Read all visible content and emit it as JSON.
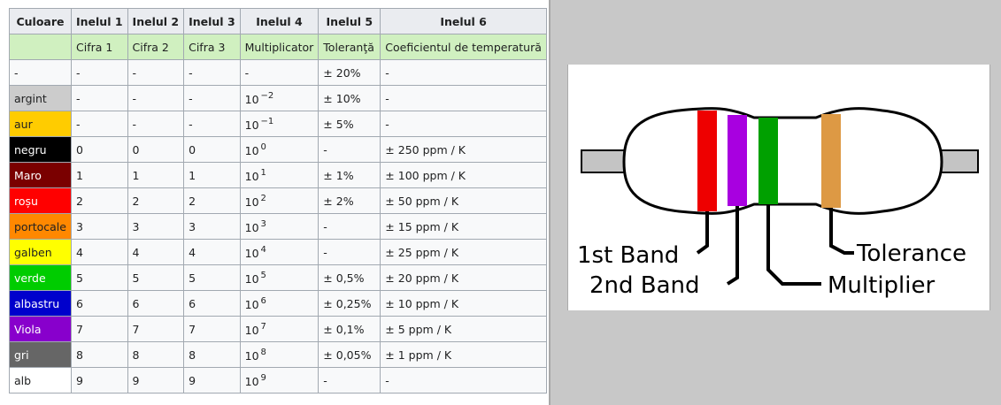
{
  "table": {
    "headers": [
      "Culoare",
      "Inelul 1",
      "Inelul 2",
      "Inelul 3",
      "Inelul 4",
      "Inelul 5",
      "Inelul 6"
    ],
    "subheaders": [
      "",
      "Cifra 1",
      "Cifra 2",
      "Cifra 3",
      "Multiplicator",
      "Toleranţă",
      "Coeficientul de temperatură"
    ],
    "rows": [
      {
        "color": "-",
        "bg": "#f8f9fa",
        "fg": "#202122",
        "d1": "-",
        "d2": "-",
        "d3": "-",
        "mult_base": "-",
        "mult_exp": "",
        "tol": "± 20%",
        "coef": "-"
      },
      {
        "color": "argint",
        "bg": "#cccccc",
        "fg": "#202122",
        "d1": "-",
        "d2": "-",
        "d3": "-",
        "mult_base": "10",
        "mult_exp": "−2",
        "tol": "± 10%",
        "coef": "-"
      },
      {
        "color": "aur",
        "bg": "#ffcc00",
        "fg": "#202122",
        "d1": "-",
        "d2": "-",
        "d3": "-",
        "mult_base": "10",
        "mult_exp": "−1",
        "tol": "± 5%",
        "coef": "-"
      },
      {
        "color": "negru",
        "bg": "#000000",
        "fg": "#ffffff",
        "d1": "0",
        "d2": "0",
        "d3": "0",
        "mult_base": "10",
        "mult_exp": "0",
        "tol": "-",
        "coef": "± 250 ppm / K"
      },
      {
        "color": "Maro",
        "bg": "#7a0000",
        "fg": "#ffffff",
        "d1": "1",
        "d2": "1",
        "d3": "1",
        "mult_base": "10",
        "mult_exp": "1",
        "tol": "± 1%",
        "coef": "± 100 ppm / K"
      },
      {
        "color": "roșu",
        "bg": "#ff0000",
        "fg": "#ffffff",
        "d1": "2",
        "d2": "2",
        "d3": "2",
        "mult_base": "10",
        "mult_exp": "2",
        "tol": "± 2%",
        "coef": "± 50 ppm / K"
      },
      {
        "color": "portocale",
        "bg": "#ff8800",
        "fg": "#202122",
        "d1": "3",
        "d2": "3",
        "d3": "3",
        "mult_base": "10",
        "mult_exp": "3",
        "tol": "-",
        "coef": "± 15 ppm / K"
      },
      {
        "color": "galben",
        "bg": "#ffff00",
        "fg": "#202122",
        "d1": "4",
        "d2": "4",
        "d3": "4",
        "mult_base": "10",
        "mult_exp": "4",
        "tol": "-",
        "coef": "± 25 ppm / K"
      },
      {
        "color": "verde",
        "bg": "#00cc00",
        "fg": "#ffffff",
        "d1": "5",
        "d2": "5",
        "d3": "5",
        "mult_base": "10",
        "mult_exp": "5",
        "tol": "± 0,5%",
        "coef": "± 20 ppm / K"
      },
      {
        "color": "albastru",
        "bg": "#0000cc",
        "fg": "#ffffff",
        "d1": "6",
        "d2": "6",
        "d3": "6",
        "mult_base": "10",
        "mult_exp": "6",
        "tol": "± 0,25%",
        "coef": "± 10 ppm / K"
      },
      {
        "color": "Viola",
        "bg": "#8800cc",
        "fg": "#ffffff",
        "d1": "7",
        "d2": "7",
        "d3": "7",
        "mult_base": "10",
        "mult_exp": "7",
        "tol": "± 0,1%",
        "coef": "± 5 ppm / K"
      },
      {
        "color": "gri",
        "bg": "#666666",
        "fg": "#ffffff",
        "d1": "8",
        "d2": "8",
        "d3": "8",
        "mult_base": "10",
        "mult_exp": "8",
        "tol": "± 0,05%",
        "coef": "± 1 ppm / K"
      },
      {
        "color": "alb",
        "bg": "#ffffff",
        "fg": "#202122",
        "d1": "9",
        "d2": "9",
        "d3": "9",
        "mult_base": "10",
        "mult_exp": "9",
        "tol": "-",
        "coef": "-"
      }
    ]
  },
  "diagram": {
    "labels": {
      "band1": "1st Band",
      "band2": "2nd Band",
      "multiplier": "Multiplier",
      "tolerance": "Tolerance"
    },
    "band_colors": {
      "band1": "#ee0000",
      "band2": "#a800e0",
      "multiplier": "#00a000",
      "tolerance": "#dd9944"
    }
  }
}
